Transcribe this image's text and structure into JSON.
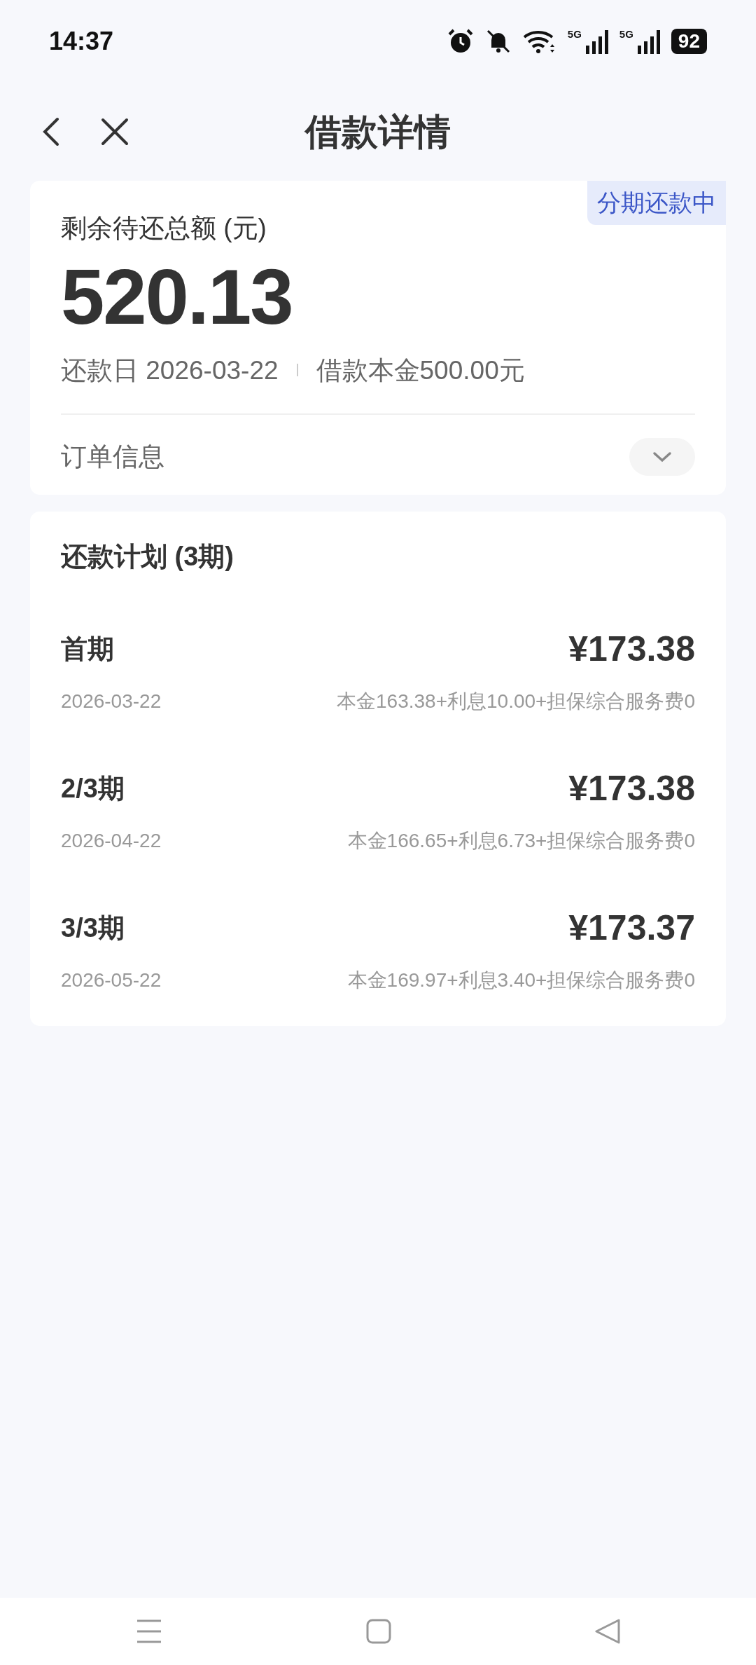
{
  "status_bar": {
    "time": "14:37",
    "network_1": "5G",
    "network_2": "5G",
    "battery": "92"
  },
  "header": {
    "title": "借款详情"
  },
  "summary": {
    "status_tag": "分期还款中",
    "label": "剩余待还总额 (元)",
    "amount": "520.13",
    "due_date": "还款日 2026-03-22",
    "principal": "借款本金500.00元",
    "order_info": "订单信息",
    "order_info_expanded": false
  },
  "plan": {
    "title": "还款计划 (3期)",
    "installments": [
      {
        "name": "首期",
        "date": "2026-03-22",
        "amount": "¥173.38",
        "breakdown": "本金163.38+利息10.00+担保综合服务费0"
      },
      {
        "name": "2/3期",
        "date": "2026-04-22",
        "amount": "¥173.38",
        "breakdown": "本金166.65+利息6.73+担保综合服务费0"
      },
      {
        "name": "3/3期",
        "date": "2026-05-22",
        "amount": "¥173.37",
        "breakdown": "本金169.97+利息3.40+担保综合服务费0"
      }
    ]
  }
}
